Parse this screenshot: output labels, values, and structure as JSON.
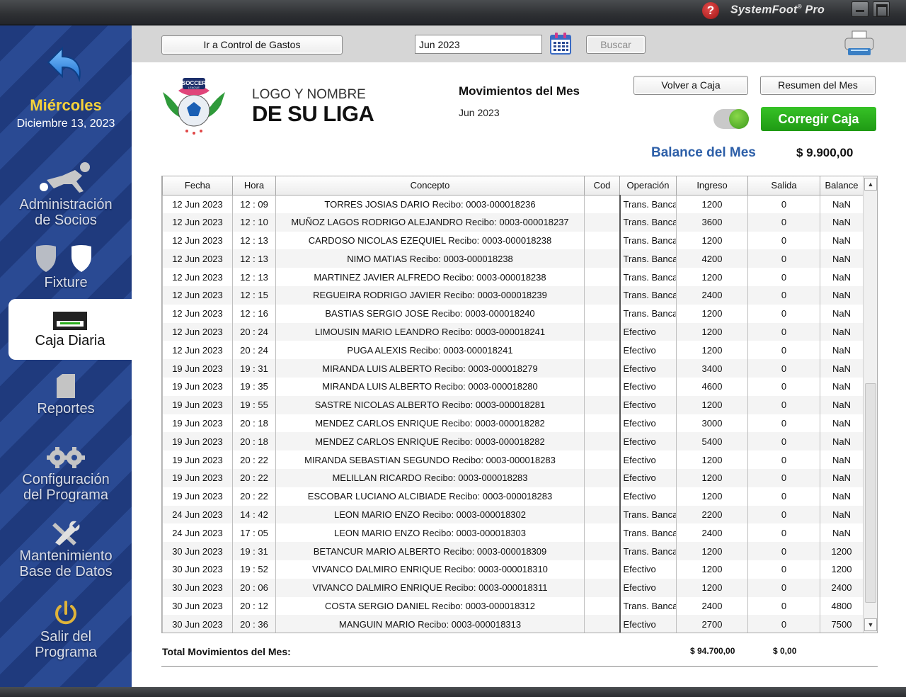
{
  "app": {
    "brand": "SystemFoot",
    "brand_suffix": "Pro",
    "help_glyph": "?"
  },
  "sidebar": {
    "day": "Miércoles",
    "date": "Diciembre 13, 2023",
    "items": [
      {
        "line1": "Administración",
        "line2": "de Socios"
      },
      {
        "line1": "Fixture",
        "line2": ""
      },
      {
        "line1": "Caja Diaria",
        "line2": ""
      },
      {
        "line1": "Reportes",
        "line2": ""
      },
      {
        "line1": "Configuración",
        "line2": "del Programa"
      },
      {
        "line1": "Mantenimiento",
        "line2": "Base de Datos"
      },
      {
        "line1": "Salir del",
        "line2": "Programa"
      }
    ]
  },
  "toolbar": {
    "gastos_label": "Ir a Control de Gastos",
    "month_value": "Jun 2023",
    "buscar_label": "Buscar"
  },
  "header": {
    "logo_badge_top": "SOCCER",
    "logo_badge_sub": "LEAGUE",
    "logo_line1": "LOGO Y NOMBRE",
    "logo_line2": "DE SU LIGA",
    "title": "Movimientos del Mes",
    "month": "Jun 2023",
    "volver_label": "Volver a Caja",
    "resumen_label": "Resumen del Mes",
    "corregir_label": "Corregir Caja",
    "balance_label": "Balance del Mes",
    "balance_value": "$ 9.900,00"
  },
  "table": {
    "columns": [
      "Fecha",
      "Hora",
      "Concepto",
      "Cod",
      "Operación",
      "Ingreso",
      "Salida",
      "Balance"
    ],
    "rows": [
      [
        "12 Jun 2023",
        "12 : 09",
        "TORRES JOSIAS DARIO Recibo: 0003-000018236",
        "",
        "Trans. Bancaria",
        "1200",
        "0",
        "NaN"
      ],
      [
        "12 Jun 2023",
        "12 : 10",
        "MUÑOZ LAGOS RODRIGO ALEJANDRO Recibo: 0003-000018237",
        "",
        "Trans. Bancaria",
        "3600",
        "0",
        "NaN"
      ],
      [
        "12 Jun 2023",
        "12 : 13",
        "CARDOSO NICOLAS EZEQUIEL Recibo: 0003-000018238",
        "",
        "Trans. Bancaria",
        "1200",
        "0",
        "NaN"
      ],
      [
        "12 Jun 2023",
        "12 : 13",
        "NIMO MATIAS Recibo: 0003-000018238",
        "",
        "Trans. Bancaria",
        "4200",
        "0",
        "NaN"
      ],
      [
        "12 Jun 2023",
        "12 : 13",
        "MARTINEZ  JAVIER ALFREDO Recibo: 0003-000018238",
        "",
        "Trans. Bancaria",
        "1200",
        "0",
        "NaN"
      ],
      [
        "12 Jun 2023",
        "12 : 15",
        "REGUEIRA RODRIGO JAVIER Recibo: 0003-000018239",
        "",
        "Trans. Bancaria",
        "2400",
        "0",
        "NaN"
      ],
      [
        "12 Jun 2023",
        "12 : 16",
        "BASTIAS SERGIO JOSE Recibo: 0003-000018240",
        "",
        "Trans. Bancaria",
        "1200",
        "0",
        "NaN"
      ],
      [
        "12 Jun 2023",
        "20 : 24",
        "LIMOUSIN MARIO LEANDRO Recibo: 0003-000018241",
        "",
        "Efectivo",
        "1200",
        "0",
        "NaN"
      ],
      [
        "12 Jun 2023",
        "20 : 24",
        "PUGA ALEXIS Recibo: 0003-000018241",
        "",
        "Efectivo",
        "1200",
        "0",
        "NaN"
      ],
      [
        "19 Jun 2023",
        "19 : 31",
        "MIRANDA LUIS ALBERTO Recibo: 0003-000018279",
        "",
        "Efectivo",
        "3400",
        "0",
        "NaN"
      ],
      [
        "19 Jun 2023",
        "19 : 35",
        "MIRANDA LUIS ALBERTO Recibo: 0003-000018280",
        "",
        "Efectivo",
        "4600",
        "0",
        "NaN"
      ],
      [
        "19 Jun 2023",
        "19 : 55",
        "SASTRE NICOLAS ALBERTO Recibo: 0003-000018281",
        "",
        "Efectivo",
        "1200",
        "0",
        "NaN"
      ],
      [
        "19 Jun 2023",
        "20 : 18",
        "MENDEZ CARLOS ENRIQUE Recibo: 0003-000018282",
        "",
        "Efectivo",
        "3000",
        "0",
        "NaN"
      ],
      [
        "19 Jun 2023",
        "20 : 18",
        "MENDEZ CARLOS ENRIQUE Recibo: 0003-000018282",
        "",
        "Efectivo",
        "5400",
        "0",
        "NaN"
      ],
      [
        "19 Jun 2023",
        "20 : 22",
        "MIRANDA SEBASTIAN SEGUNDO Recibo: 0003-000018283",
        "",
        "Efectivo",
        "1200",
        "0",
        "NaN"
      ],
      [
        "19 Jun 2023",
        "20 : 22",
        "MELILLAN RICARDO Recibo: 0003-000018283",
        "",
        "Efectivo",
        "1200",
        "0",
        "NaN"
      ],
      [
        "19 Jun 2023",
        "20 : 22",
        "ESCOBAR LUCIANO ALCIBIADE Recibo: 0003-000018283",
        "",
        "Efectivo",
        "1200",
        "0",
        "NaN"
      ],
      [
        "24 Jun 2023",
        "14 : 42",
        "LEON MARIO ENZO Recibo: 0003-000018302",
        "",
        "Trans. Bancaria",
        "2200",
        "0",
        "NaN"
      ],
      [
        "24 Jun 2023",
        "17 : 05",
        "LEON MARIO ENZO Recibo: 0003-000018303",
        "",
        "Trans. Bancaria",
        "2400",
        "0",
        "NaN"
      ],
      [
        "30 Jun 2023",
        "19 : 31",
        "BETANCUR MARIO ALBERTO Recibo: 0003-000018309",
        "",
        "Trans. Bancaria",
        "1200",
        "0",
        "1200"
      ],
      [
        "30 Jun 2023",
        "19 : 52",
        "VIVANCO DALMIRO  ENRIQUE Recibo: 0003-000018310",
        "",
        "Efectivo",
        "1200",
        "0",
        "1200"
      ],
      [
        "30 Jun 2023",
        "20 : 06",
        "VIVANCO DALMIRO  ENRIQUE Recibo: 0003-000018311",
        "",
        "Efectivo",
        "1200",
        "0",
        "2400"
      ],
      [
        "30 Jun 2023",
        "20 : 12",
        "COSTA SERGIO DANIEL Recibo: 0003-000018312",
        "",
        "Trans. Bancaria",
        "2400",
        "0",
        "4800"
      ],
      [
        "30 Jun 2023",
        "20 : 36",
        "MANGUIN MARIO Recibo: 0003-000018313",
        "",
        "Efectivo",
        "2700",
        "0",
        "7500"
      ]
    ]
  },
  "totals": {
    "label": "Total Movimientos del Mes:",
    "ingreso": "$ 94.700,00",
    "salida": "$ 0,00"
  },
  "colors": {
    "sidebar": "#1f3a7d",
    "accent_yellow": "#f6d23a",
    "balance_blue": "#2d5fa8",
    "corregir_green": "#2aad1c"
  },
  "icons": {
    "back": "back-arrow-icon",
    "socios": "player-kick-icon",
    "fixture": "shields-icon",
    "caja": "cash-drawer-icon",
    "reportes": "document-icon",
    "config": "gears-icon",
    "mantenimiento": "tools-icon",
    "salir": "power-icon",
    "calendar": "calendar-icon",
    "printer": "printer-icon"
  }
}
